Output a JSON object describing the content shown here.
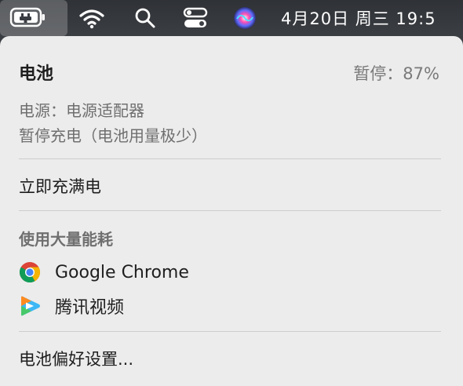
{
  "menubar": {
    "icons": [
      "battery-icon",
      "wifi-icon",
      "search-icon",
      "control-center-icon",
      "siri-icon"
    ],
    "clock": "4月20日 周三  19:5"
  },
  "battery_menu": {
    "title": "电池",
    "status": "暂停：87%",
    "power_source": "电源：电源适配器",
    "charging_note": "暂停充电（电池用量极少）",
    "charge_now": "立即充满电",
    "significant_energy_heading": "使用大量能耗",
    "apps": [
      {
        "name": "Google Chrome",
        "icon": "chrome-icon"
      },
      {
        "name": "腾讯视频",
        "icon": "tencent-video-icon"
      }
    ],
    "preferences": "电池偏好设置..."
  }
}
